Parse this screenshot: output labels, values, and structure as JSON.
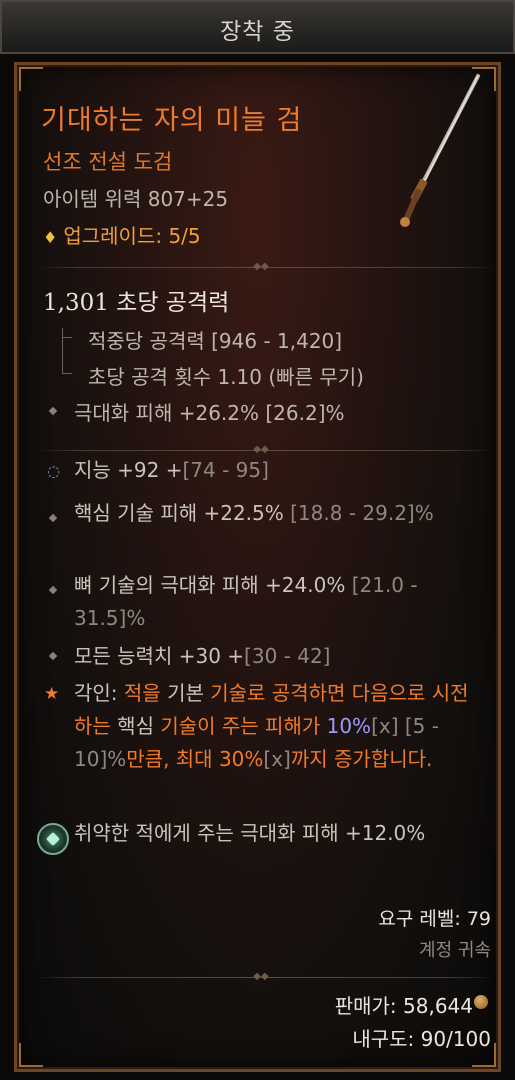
{
  "header": {
    "title": "장착 중"
  },
  "item": {
    "name": "기대하는 자의 미늘 검",
    "type": "선조 전설 도검",
    "power": "아이템 위력 807+25",
    "upgrade": "업그레이드: 5/5",
    "icon": "sword-icon"
  },
  "dps": "1,301 초당 공격력",
  "weapon_stats": {
    "damage": "적중당 공격력 [946 - 1,420]",
    "attack_speed": "초당 공격 횟수 1.10 (빠른 무기)",
    "crit_damage": "극대화 피해 +26.2% [26.2]%"
  },
  "affixes": {
    "intelligence_value": "지능 +92 +",
    "intelligence_range": "[74 - 95]",
    "core_value": "핵심 기술 피해 +22.5% ",
    "core_range": "[18.8 - 29.2]%",
    "bone_value": "뼈 기술의 극대화 피해 +24.0% ",
    "bone_range": "[21.0 - 31.5]%",
    "all_value": "모든 능력치 +30 +",
    "all_range": "[30 - 42]"
  },
  "aspect": {
    "label": "각인: ",
    "p1": "적을",
    "p2": " 기본 ",
    "p3": "기술로 공격하면 다음으로 시전하는",
    "p4": " 핵심 ",
    "p5": "기술이 주는 피해가",
    "p6": " 10%",
    "p7": "[x]",
    "p8": " [5 - 10]%",
    "p9": "만큼, 최대 30%",
    "p10": "[x]",
    "p11": "까지 증가합니다."
  },
  "socket": {
    "text": "취약한 적에게 주는 극대화 피해 +12.0%"
  },
  "footer": {
    "required_level": "요구 레벨: 79",
    "account_bound": "계정 귀속",
    "sell_value": "판매가: 58,644",
    "durability": "내구도: 90/100"
  },
  "colors": {
    "legendary": "#f07a2a",
    "gold": "#f0c040",
    "frame": "#6a4626"
  }
}
